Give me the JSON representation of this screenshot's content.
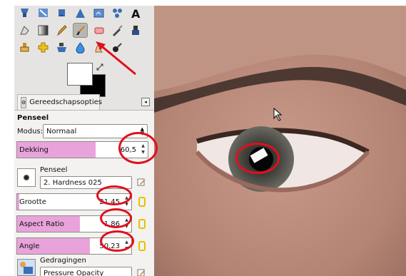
{
  "tabs": {
    "tool_options_label": "Gereedschapsopties"
  },
  "tool_options": {
    "title": "Penseel",
    "mode_label": "Modus:",
    "mode_value": "Normaal",
    "opacity": {
      "label": "Dekking",
      "value": "60,5",
      "fraction": 0.6
    },
    "brush": {
      "label": "Penseel",
      "value": "2. Hardness 025"
    },
    "size": {
      "label": "Grootte",
      "value": "21,45",
      "fraction": 0.02
    },
    "aspect_ratio": {
      "label": "Aspect Ratio",
      "value": "1,86",
      "fraction": 0.55
    },
    "angle": {
      "label": "Angle",
      "value": "50,23",
      "fraction": 0.64
    },
    "dynamics": {
      "label": "Gedragingen",
      "value": "Pressure Opacity"
    }
  },
  "toolbox": {
    "row1": [
      "clone-stamp-icon",
      "heal-icon",
      "bucket-icon",
      "warp-icon",
      "crop-icon",
      "select-icon",
      "text-tool-icon"
    ],
    "row2": [
      "smudge-icon",
      "gradient-icon",
      "pencil-icon",
      "paintbrush-icon",
      "eraser-icon",
      "airbrush-icon",
      "ink-icon"
    ],
    "row3": [
      "clone-icon",
      "heal-cross-icon",
      "perspective-clone-icon",
      "blur-icon",
      "smudge-finger-icon",
      "dodge-burn-icon"
    ]
  },
  "colors": {
    "foreground": "#ffffff",
    "background": "#000000",
    "accent_highlight": "#e0101c",
    "slider_fill": "#e9a3db"
  }
}
